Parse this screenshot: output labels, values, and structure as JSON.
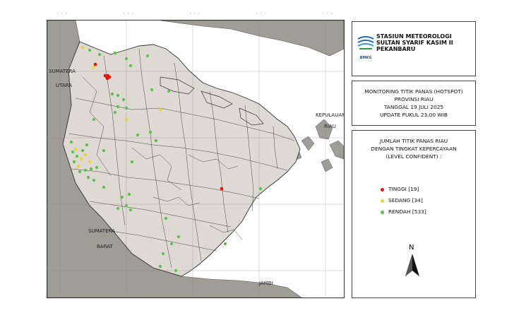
{
  "map": {
    "place_labels": {
      "sumatera_utara_1": "SUMATERA",
      "sumatera_utara_2": "UTARA",
      "sumatera_barat_1": "SUMATERA",
      "sumatera_barat_2": "BARAT",
      "kepulauan_riau_1": "KEPULAUAN",
      "kepulauan_riau_2": "RIAU",
      "jambi": "JAMBI"
    },
    "colors": {
      "sea": "#ffffff",
      "neighbor_land": "#a09c96",
      "riau": "#ded9d2",
      "boundary": "#333333",
      "tinggi": "#e8140c",
      "sedang": "#f3d22a",
      "rendah": "#58c24a"
    },
    "north_label": "N",
    "north_arrow_icon": "north-arrow-icon"
  },
  "header": {
    "logo_text": "BMKG",
    "logo_icon": "bmkg-logo-icon",
    "station_line1": "STASIUN METEOROLOGI",
    "station_line2": "SULTAN SYARIF KASIM II",
    "station_line3": "PEKANBARU"
  },
  "title": {
    "line1": "MONITORING TITIK PANAS (HOTSPOT)",
    "line2": "PROVINSI RIAU",
    "line3": "TANGGAL 19 JULI 2025",
    "line4": "UPDATE PUKUL 23.00 WIB"
  },
  "legend": {
    "heading1": "JUMLAH TITIK PANAS RIAU",
    "heading2": "DENGAN TINGKAT KEPERCAYAAN",
    "heading3": "(LEVEL CONFIDENT) :",
    "items": [
      {
        "label": "TINGGI [19]",
        "color": "#e8140c"
      },
      {
        "label": "SEDANG [34]",
        "color": "#f3d22a"
      },
      {
        "label": "RENDAH [533]",
        "color": "#58c24a"
      }
    ]
  }
}
